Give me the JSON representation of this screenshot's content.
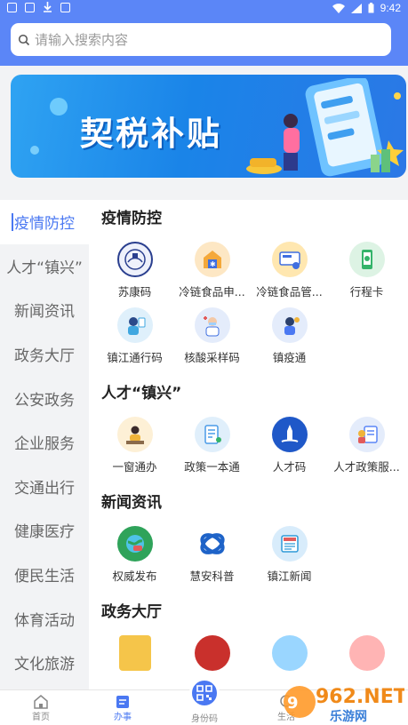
{
  "status_bar": {
    "time": "9:42"
  },
  "search": {
    "placeholder": "请输入搜索内容"
  },
  "banner": {
    "title": "契税补贴"
  },
  "sidebar": {
    "items": [
      {
        "label": "疫情防控",
        "active": true
      },
      {
        "label": "人才“镇兴”",
        "active": false
      },
      {
        "label": "新闻资讯",
        "active": false
      },
      {
        "label": "政务大厅",
        "active": false
      },
      {
        "label": "公安政务",
        "active": false
      },
      {
        "label": "企业服务",
        "active": false
      },
      {
        "label": "交通出行",
        "active": false
      },
      {
        "label": "健康医疗",
        "active": false
      },
      {
        "label": "便民生活",
        "active": false
      },
      {
        "label": "体育活动",
        "active": false
      },
      {
        "label": "文化旅游",
        "active": false
      }
    ]
  },
  "sections": [
    {
      "title": "疫情防控",
      "tiles": [
        {
          "label": "苏康码",
          "icon": "sukangma-icon",
          "color": "#2a3f8f"
        },
        {
          "label": "冷链食品申...",
          "icon": "cold-chain-declare-icon",
          "color": "#f4a83a"
        },
        {
          "label": "冷链食品管...",
          "icon": "cold-chain-manage-icon",
          "color": "#3f6fe0"
        },
        {
          "label": "行程卡",
          "icon": "travel-card-icon",
          "color": "#34b36a"
        },
        {
          "label": "镇江通行码",
          "icon": "zhenjiang-pass-icon",
          "color": "#3fa7e0"
        },
        {
          "label": "核酸采样码",
          "icon": "nucleic-sample-icon",
          "color": "#e25b5b"
        },
        {
          "label": "镇疫通",
          "icon": "zhenyitong-icon",
          "color": "#4a78f2"
        }
      ]
    },
    {
      "title": "人才“镇兴”",
      "tiles": [
        {
          "label": "一窗通办",
          "icon": "one-window-icon",
          "color": "#f0b43a"
        },
        {
          "label": "政策一本通",
          "icon": "policy-book-icon",
          "color": "#4a9be8"
        },
        {
          "label": "人才码",
          "icon": "talent-code-icon",
          "color": "#1f58c8"
        },
        {
          "label": "人才政策服...",
          "icon": "talent-policy-icon",
          "color": "#5b86f7"
        }
      ]
    },
    {
      "title": "新闻资讯",
      "tiles": [
        {
          "label": "权威发布",
          "icon": "official-release-icon",
          "color": "#2fa35a"
        },
        {
          "label": "慧安科普",
          "icon": "huian-science-icon",
          "color": "#1e63c8"
        },
        {
          "label": "镇江新闻",
          "icon": "zhenjiang-news-icon",
          "color": "#2f9ad8"
        }
      ]
    },
    {
      "title": "政务大厅",
      "tiles": []
    }
  ],
  "tabbar": {
    "tabs": [
      {
        "label": "首页",
        "active": false
      },
      {
        "label": "办事",
        "active": true
      },
      {
        "label": "身份码",
        "active": false
      },
      {
        "label": "生活",
        "active": false
      }
    ]
  },
  "watermark": {
    "brand": "962.NET",
    "subtitle": "乐游网"
  }
}
